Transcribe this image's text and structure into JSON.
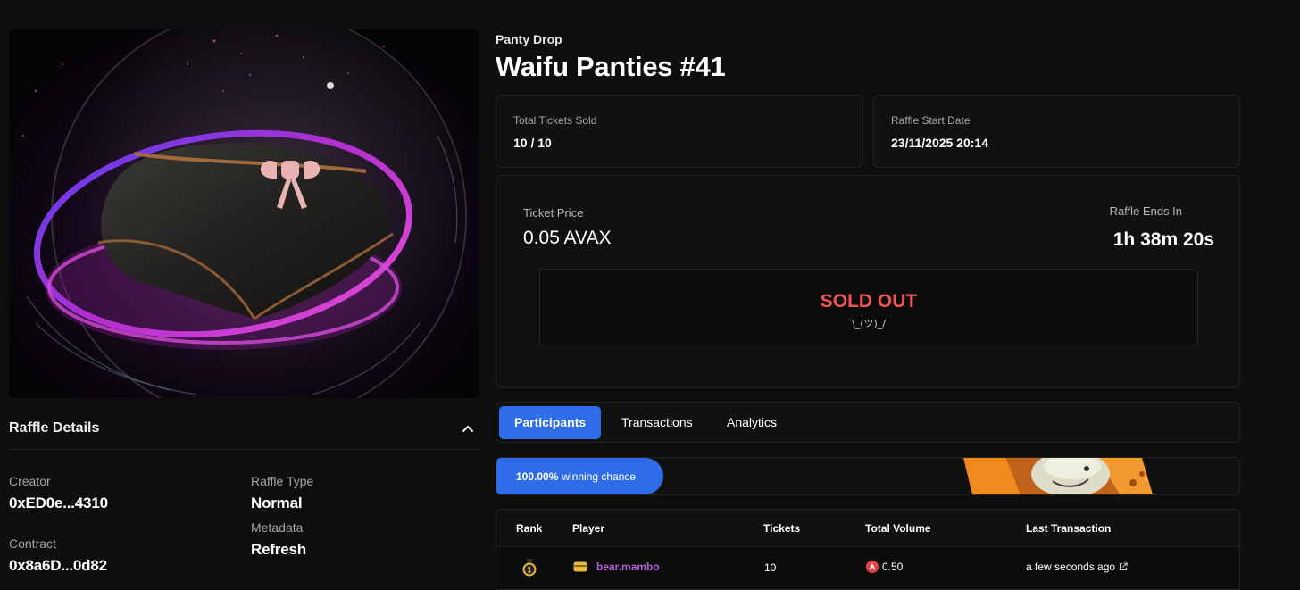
{
  "raffle": {
    "collection": "Panty Drop",
    "title": "Waifu Panties #41"
  },
  "stats": {
    "tickets_sold_label": "Total Tickets Sold",
    "tickets_sold_value": "10 / 10",
    "start_date_label": "Raffle Start Date",
    "start_date_value": "23/11/2025 20:14"
  },
  "pricing": {
    "ticket_price_label": "Ticket Price",
    "ticket_price_value": "0.05 AVAX",
    "ends_label": "Raffle Ends In",
    "ends_value": "1h 38m 20s",
    "sold_out_label": "SOLD OUT",
    "shrug": "¯\\_(ツ)_/¯"
  },
  "details": {
    "title": "Raffle Details",
    "creator_label": "Creator",
    "creator_value": "0xED0e...4310",
    "contract_label": "Contract",
    "contract_value": "0x8a6D...0d82",
    "type_label": "Raffle Type",
    "type_value": "Normal",
    "metadata_label": "Metadata",
    "metadata_action": "Refresh"
  },
  "tabs": [
    {
      "label": "Participants",
      "active": true
    },
    {
      "label": "Transactions",
      "active": false
    },
    {
      "label": "Analytics",
      "active": false
    }
  ],
  "chance": {
    "percent": "100.00%",
    "text": "winning chance"
  },
  "table": {
    "headers": [
      "Rank",
      "Player",
      "Tickets",
      "Total Volume",
      "Last Transaction"
    ],
    "rows": [
      {
        "rank": 1,
        "player": "bear.mambo",
        "tickets": "10",
        "volume": "0.50",
        "last_tx": "a few seconds ago"
      }
    ]
  },
  "icons": {
    "chevron": "chevron-up-icon",
    "wallet": "wallet-icon",
    "avax": "avax-icon",
    "external": "external-link-icon",
    "medal": "gold-medal-icon"
  },
  "colors": {
    "accent": "#2f6de8",
    "sold_out": "#f05454",
    "player": "#b15fd6",
    "background": "#0e0e0e"
  }
}
